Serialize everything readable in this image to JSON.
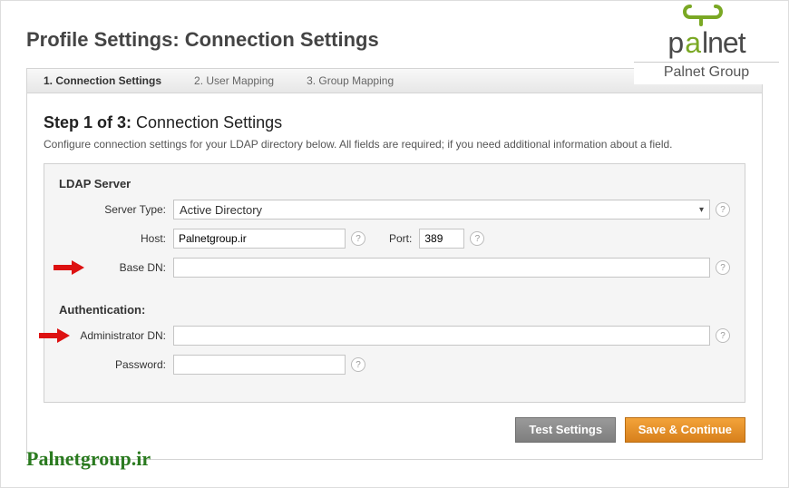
{
  "header": {
    "title": "Profile Settings: Connection Settings"
  },
  "tabs": [
    {
      "label": "1. Connection Settings",
      "active": true
    },
    {
      "label": "2. User Mapping",
      "active": false
    },
    {
      "label": "3. Group Mapping",
      "active": false
    }
  ],
  "step": {
    "prefix": "Step 1 of 3:",
    "name": "Connection Settings",
    "desc": "Configure connection settings for your LDAP directory below. All fields are required; if you need additional information about a field."
  },
  "ldap": {
    "section_label": "LDAP Server",
    "server_type_label": "Server Type:",
    "server_type_value": "Active Directory",
    "host_label": "Host:",
    "host_value": "Palnetgroup.ir",
    "port_label": "Port:",
    "port_value": "389",
    "base_dn_label": "Base DN:",
    "base_dn_value": ""
  },
  "auth": {
    "section_label": "Authentication:",
    "admin_dn_label": "Administrator DN:",
    "admin_dn_value": "",
    "password_label": "Password:",
    "password_value": ""
  },
  "buttons": {
    "test": "Test Settings",
    "save": "Save & Continue"
  },
  "logo": {
    "brand_p1": "p",
    "brand_a": "a",
    "brand_rest": "lnet",
    "sub": "Palnet Group"
  },
  "footer": {
    "brand": "Palnetgroup.ir"
  },
  "help_glyph": "?"
}
